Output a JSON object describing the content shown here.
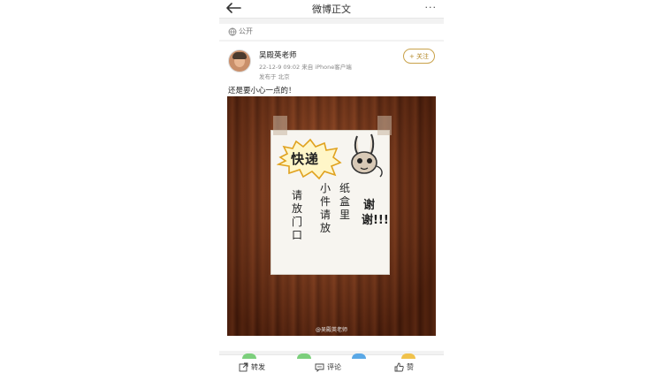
{
  "header": {
    "title": "微博正文",
    "more_label": "···"
  },
  "visibility": {
    "label": "公开"
  },
  "post": {
    "username": "吴殿英老师",
    "meta_line": "22-12-9 09:02 来自 iPhone客户端",
    "location_line": "发布于 北京",
    "follow_label": "+ 关注",
    "text": "还是要小心一点的！",
    "photo": {
      "headline": "快递",
      "col1": "请放门口",
      "col2": "小件请放",
      "col3": "纸盒里",
      "col4": "谢谢!!!",
      "watermark": "@吴殿英老师"
    }
  },
  "actions": {
    "repost": "转发",
    "comment": "评论",
    "like": "赞"
  },
  "colors": {
    "accent": "#b48a2c",
    "wood": "#6b2b12"
  }
}
